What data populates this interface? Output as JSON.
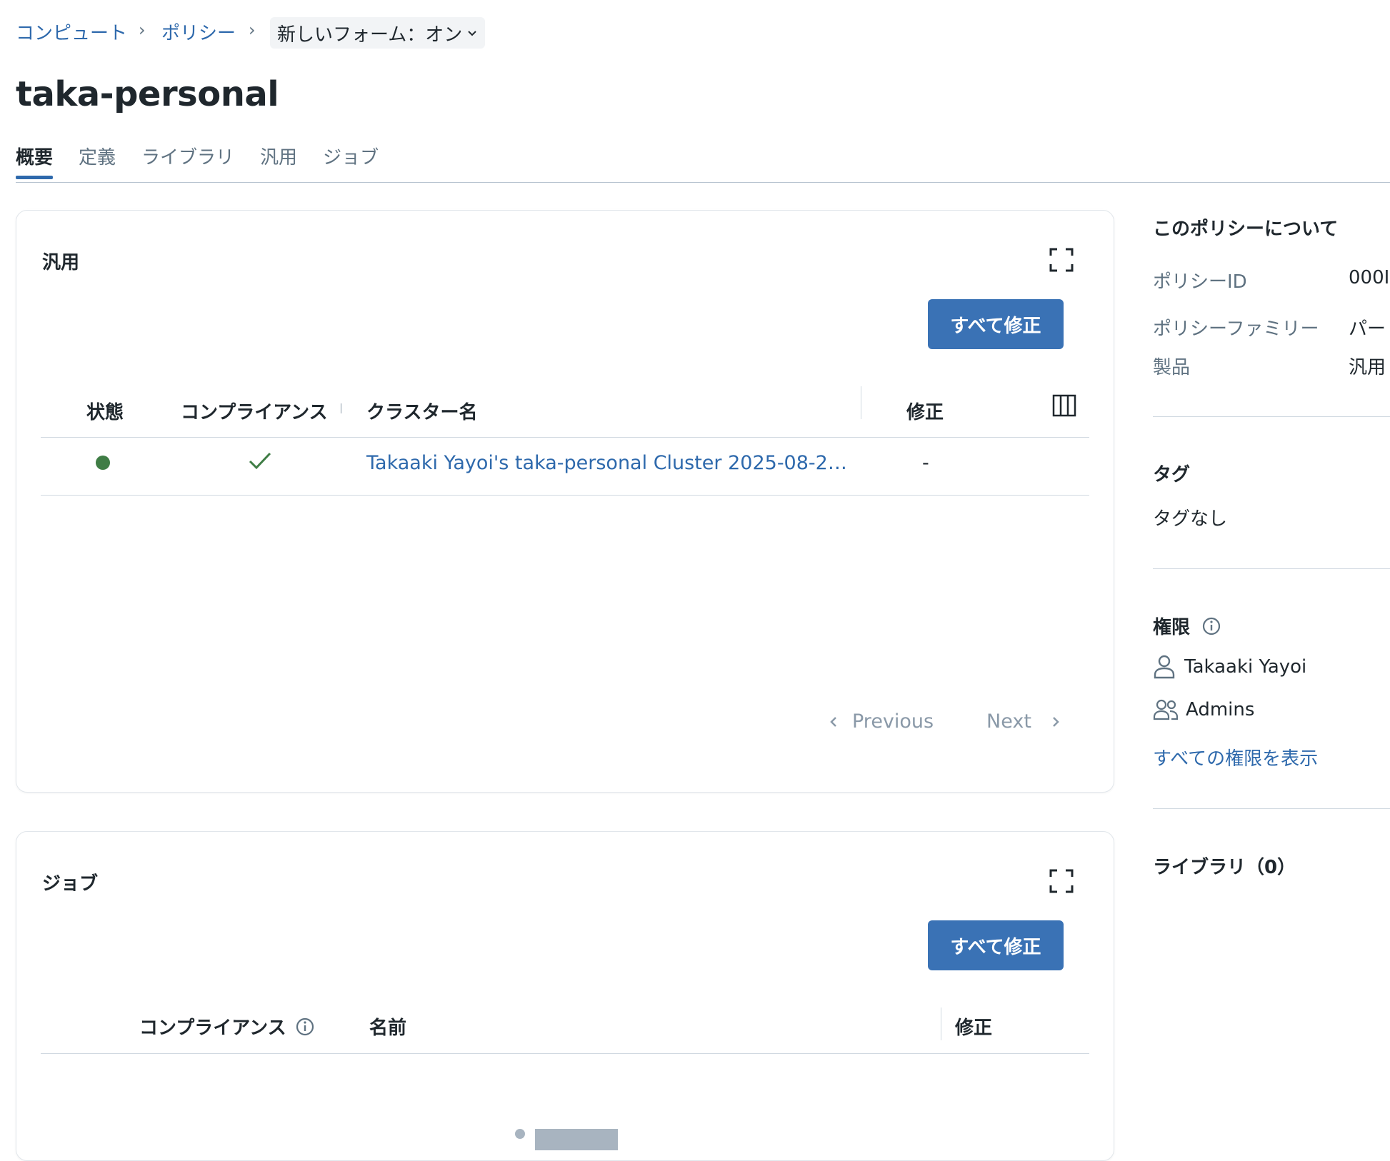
{
  "breadcrumb": {
    "items": [
      "コンピュート",
      "ポリシー"
    ],
    "toggle": "新しいフォーム：オン"
  },
  "page": {
    "title": "taka-personal"
  },
  "tabs": [
    "概要",
    "定義",
    "ライブラリ",
    "汎用",
    "ジョブ"
  ],
  "general_card": {
    "title": "汎用",
    "fix_all": "すべて修正",
    "columns": [
      "状態",
      "コンプライアンス",
      "クラスター名",
      "修正"
    ],
    "rows": [
      {
        "status": "green",
        "compliant": true,
        "name": "Takaaki Yayoi's taka-personal Cluster 2025-08-2…",
        "fix": "-"
      }
    ],
    "pagination": {
      "previous": "Previous",
      "next": "Next"
    }
  },
  "jobs_card": {
    "title": "ジョブ",
    "fix_all": "すべて修正",
    "columns": [
      "コンプライアンス",
      "名前",
      "修正"
    ]
  },
  "sidebar": {
    "about_title": "このポリシーについて",
    "policy_id_label": "ポリシーID",
    "policy_id_value": "000I",
    "family_label": "ポリシーファミリー",
    "family_value": "パー",
    "product_label": "製品",
    "product_value": "汎用",
    "tags_title": "タグ",
    "tags_empty": "タグなし",
    "permissions_title": "権限",
    "permission_user": "Takaaki Yayoi",
    "permission_group": "Admins",
    "view_all_permissions": "すべての権限を表示",
    "libraries_title": "ライブラリ（0）"
  },
  "colors": {
    "accent": "#2e69ac",
    "primary_button": "#3a72b5",
    "status_green": "#3f7d45"
  }
}
